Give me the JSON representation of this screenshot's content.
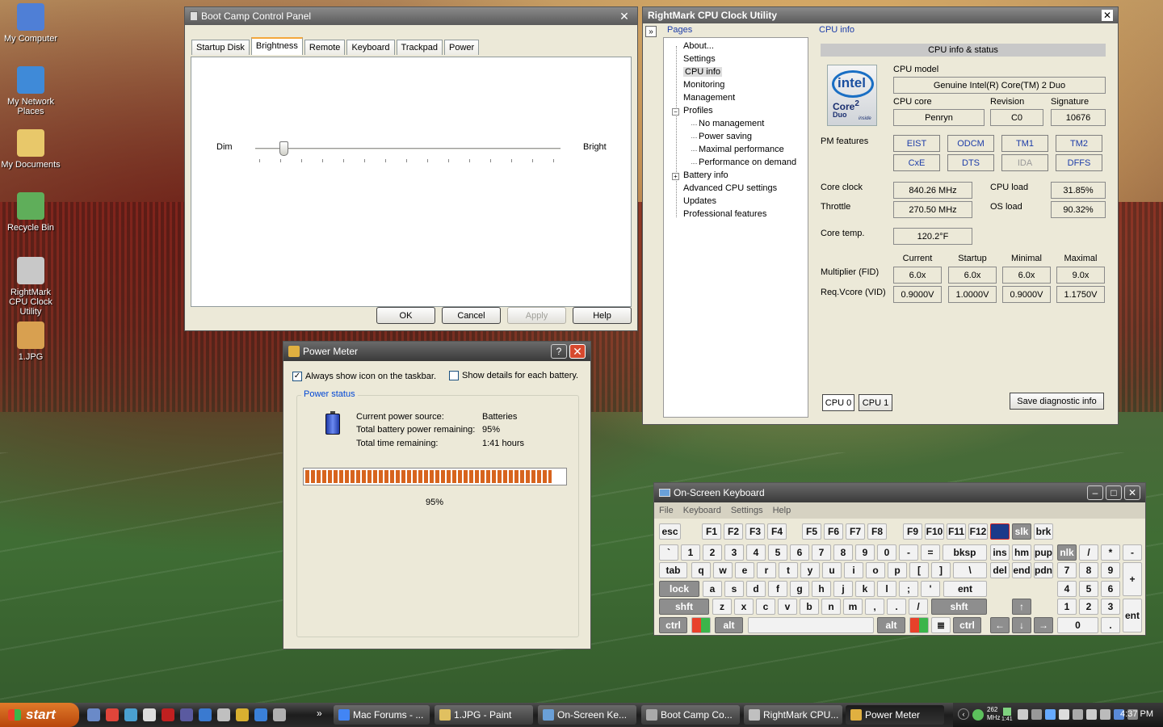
{
  "desktop": {
    "icons": [
      {
        "label": "My Computer",
        "color": "#4f7fd6"
      },
      {
        "label": "My Network Places",
        "color": "#3f8ad8"
      },
      {
        "label": "My Documents",
        "color": "#e8c86a"
      },
      {
        "label": "Recycle Bin",
        "color": "#5fae5a"
      },
      {
        "label": "RightMark CPU Clock Utility",
        "color": "#c8c8c8"
      },
      {
        "label": "1.JPG",
        "color": "#d8a050"
      }
    ]
  },
  "bootcamp": {
    "title": "Boot Camp Control Panel",
    "tabs": [
      "Startup Disk",
      "Brightness",
      "Remote",
      "Keyboard",
      "Trackpad",
      "Power"
    ],
    "active_tab": "Brightness",
    "dim_label": "Dim",
    "bright_label": "Bright",
    "brightness_fraction": 0.08,
    "buttons": {
      "ok": "OK",
      "cancel": "Cancel",
      "apply": "Apply",
      "help": "Help"
    }
  },
  "rightmark": {
    "title": "RightMark CPU Clock Utility",
    "pages_label": "Pages",
    "tree": [
      {
        "label": "About...",
        "level": 0
      },
      {
        "label": "Settings",
        "level": 0
      },
      {
        "label": "CPU info",
        "level": 0,
        "selected": true
      },
      {
        "label": "Monitoring",
        "level": 0
      },
      {
        "label": "Management",
        "level": 0
      },
      {
        "label": "Profiles",
        "level": 0,
        "expander": "−"
      },
      {
        "label": "No management",
        "level": 1
      },
      {
        "label": "Power saving",
        "level": 1
      },
      {
        "label": "Maximal performance",
        "level": 1
      },
      {
        "label": "Performance on demand",
        "level": 1
      },
      {
        "label": "Battery info",
        "level": 0,
        "expander": "+"
      },
      {
        "label": "Advanced CPU settings",
        "level": 0
      },
      {
        "label": "Updates",
        "level": 0
      },
      {
        "label": "Professional features",
        "level": 0
      }
    ],
    "page_title": "CPU info",
    "section_title": "CPU info & status",
    "logo": {
      "brand": "intel",
      "line1": "Core",
      "line2": "2",
      "line3": "Duo",
      "inside": "inside"
    },
    "cpu_model_label": "CPU model",
    "cpu_model": "Genuine Intel(R) Core(TM) 2 Duo",
    "cpu_core_label": "CPU core",
    "cpu_core": "Penryn",
    "revision_label": "Revision",
    "revision": "C0",
    "signature_label": "Signature",
    "signature": "10676",
    "pm_features_label": "PM features",
    "pm_features": [
      {
        "label": "EIST",
        "enabled": true
      },
      {
        "label": "ODCM",
        "enabled": true
      },
      {
        "label": "TM1",
        "enabled": true
      },
      {
        "label": "TM2",
        "enabled": true
      },
      {
        "label": "CxE",
        "enabled": true
      },
      {
        "label": "DTS",
        "enabled": true
      },
      {
        "label": "IDA",
        "enabled": false
      },
      {
        "label": "DFFS",
        "enabled": true
      }
    ],
    "core_clock_label": "Core clock",
    "core_clock": "840.26 MHz",
    "cpu_load_label": "CPU load",
    "cpu_load": "31.85%",
    "throttle_label": "Throttle",
    "throttle": "270.50 MHz",
    "os_load_label": "OS load",
    "os_load": "90.32%",
    "core_temp_label": "Core temp.",
    "core_temp": "120.2°F",
    "col_headers": [
      "Current",
      "Startup",
      "Minimal",
      "Maximal"
    ],
    "multiplier_label": "Multiplier (FID)",
    "multiplier": [
      "6.0x",
      "6.0x",
      "6.0x",
      "9.0x"
    ],
    "vcore_label": "Req.Vcore (VID)",
    "vcore": [
      "0.9000V",
      "1.0000V",
      "0.9000V",
      "1.1750V"
    ],
    "cpu_tabs": [
      "CPU 0",
      "CPU 1"
    ],
    "save_button": "Save diagnostic info"
  },
  "power_meter": {
    "title": "Power Meter",
    "always_show_label": "Always show icon on the taskbar.",
    "always_show_checked": true,
    "show_details_label": "Show details for each battery.",
    "show_details_checked": false,
    "group_title": "Power status",
    "source_label": "Current power source:",
    "source_value": "Batteries",
    "remaining_label": "Total battery power remaining:",
    "remaining_value": "95%",
    "time_label": "Total time remaining:",
    "time_value": "1:41 hours",
    "progress_fraction": 0.95,
    "progress_label": "95%"
  },
  "osk": {
    "title": "On-Screen Keyboard",
    "menu": [
      "File",
      "Keyboard",
      "Settings",
      "Help"
    ]
  },
  "taskbar": {
    "start_label": "start",
    "tasks": [
      {
        "label": "Mac Forums - ...",
        "color": "#4285f4"
      },
      {
        "label": "1.JPG - Paint",
        "color": "#e0c060"
      },
      {
        "label": "On-Screen Ke...",
        "color": "#6aa0d8"
      },
      {
        "label": "Boot Camp Co...",
        "color": "#aaaaaa"
      },
      {
        "label": "RightMark CPU...",
        "color": "#c0c0c0"
      },
      {
        "label": "Power Meter",
        "color": "#e0b040",
        "active": true
      }
    ],
    "tray_freq": "262",
    "tray_freq_unit": "MHz",
    "tray_battery": "1:41",
    "clock": "4:37 PM"
  }
}
